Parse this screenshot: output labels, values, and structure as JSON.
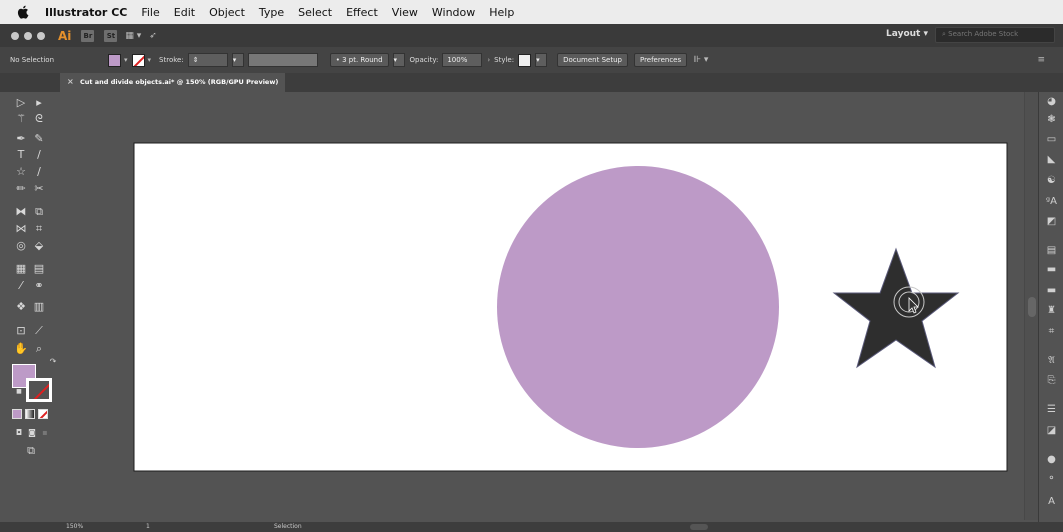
{
  "menubar": {
    "app_name": "Illustrator CC",
    "items": [
      "File",
      "Edit",
      "Object",
      "Type",
      "Select",
      "Effect",
      "View",
      "Window",
      "Help"
    ]
  },
  "appbar": {
    "logo": "Ai",
    "br": "Br",
    "st": "St",
    "layout_label": "Layout",
    "search_placeholder": "Search Adobe Stock"
  },
  "control_bar": {
    "selection_label": "No Selection",
    "fill_color": "#bd9ac7",
    "stroke_label": "Stroke:",
    "brush_label": "3 pt. Round",
    "opacity_label": "Opacity:",
    "opacity_value": "100%",
    "style_label": "Style:",
    "document_setup": "Document Setup",
    "preferences": "Preferences"
  },
  "document_tab": {
    "title": "Cut and divide objects.ai* @ 150% (RGB/GPU Preview)"
  },
  "canvas": {
    "circle_color": "#bd9ac7",
    "star_color": "#2e2e2e"
  },
  "status_bar": {
    "zoom": "150%",
    "page": "1",
    "tool": "Selection"
  }
}
